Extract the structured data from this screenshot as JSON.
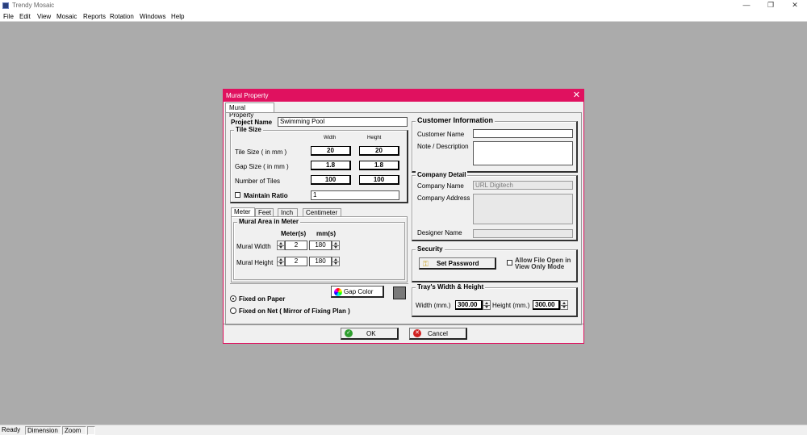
{
  "app": {
    "title": "Trendy Mosaic",
    "window_controls": [
      "—",
      "❐",
      "✕"
    ]
  },
  "menu": [
    "File",
    "Edit",
    "View",
    "Mosaic",
    "Reports",
    "Rotation",
    "Windows",
    "Help"
  ],
  "status": [
    "Ready",
    "Dimension",
    "Zoom"
  ],
  "dialog": {
    "title": "Mural Property",
    "close": "✕",
    "tab": "Mural Property",
    "project_name_label": "Project Name",
    "project_name_value": "Swimming Pool",
    "tile_size": {
      "title": "Tile Size",
      "col_width": "Width",
      "col_height": "Height",
      "rows": [
        {
          "label": "Tile Size ( in mm )",
          "width": "20",
          "height": "20"
        },
        {
          "label": "Gap Size  ( in mm )",
          "width": "1.8",
          "height": "1.8"
        },
        {
          "label": "Number of Tiles",
          "width": "100",
          "height": "100"
        }
      ],
      "maintain_ratio_label": "Maintain Ratio",
      "ratio_value": "1"
    },
    "unit_tabs": [
      "Meter",
      "Feet",
      "Inch",
      "Centimeter"
    ],
    "mural_area": {
      "title": "Mural Area in Meter",
      "col_meters": "Meter(s)",
      "col_mm": "mm(s)",
      "width_label": "Mural Width",
      "width_meters": "2",
      "width_mm": "180",
      "height_label": "Mural Height",
      "height_meters": "2",
      "height_mm": "180"
    },
    "gap_color_label": "Gap Color",
    "fixed_on_paper": "Fixed on Paper",
    "fixed_on_net": "Fixed on Net ( Mirror of Fixing Plan )",
    "customer": {
      "title": "Customer Information",
      "name_label": "Customer Name",
      "note_label": "Note / Description",
      "name_value": "",
      "note_value": ""
    },
    "company": {
      "title": "Company Detail",
      "name_label": "Company Name",
      "name_value": "URL Digitech",
      "address_label": "Company Address",
      "designer_label": "Designer Name",
      "address_value": "",
      "designer_value": ""
    },
    "security": {
      "title": "Security",
      "set_password": "Set Password",
      "allow_line1": "Allow File Open in",
      "allow_line2": "View Only Mode"
    },
    "tray": {
      "title": "Tray's Width & Height",
      "width_label": "Width (mm.)",
      "width_value": "300.00",
      "height_label": "Height (mm.)",
      "height_value": "300.00"
    },
    "ok": "OK",
    "cancel": "Cancel"
  },
  "colors": {
    "dialog_accent": "#e0115f",
    "workspace": "#ababab",
    "ok_icon": "#2e9e2e",
    "cancel_icon": "#d02020",
    "gap_swatch": "#7a7a7a"
  }
}
